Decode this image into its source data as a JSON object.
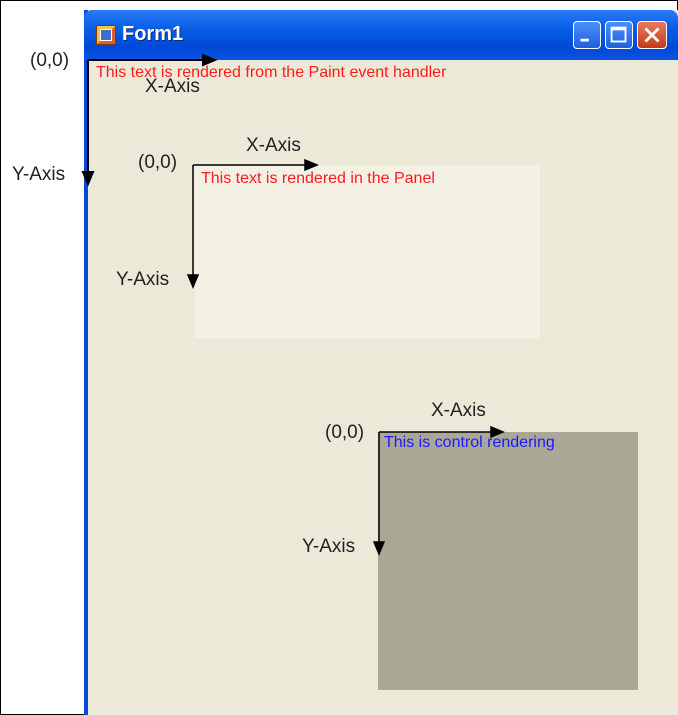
{
  "window": {
    "title": "Form1",
    "controls": {
      "minimize_icon": "minimize-icon",
      "maximize_icon": "maximize-icon",
      "close_icon": "close-icon"
    }
  },
  "form_paint": {
    "origin": "(0,0)",
    "x_axis": "X-Axis",
    "y_axis": "Y-Axis",
    "text": "This text is rendered from the Paint event handler"
  },
  "panel_paint": {
    "origin": "(0,0)",
    "x_axis": "X-Axis",
    "y_axis": "Y-Axis",
    "text": "This text is rendered in the Panel"
  },
  "control_paint": {
    "origin": "(0,0)",
    "x_axis": "X-Axis",
    "y_axis": "Y-Axis",
    "text": "This is control rendering"
  },
  "colors": {
    "window_border": "#0a49d8",
    "form_bg": "#ece9d8",
    "panel_bg": "#f3f0e4",
    "control_bg": "#aaa796",
    "red_text": "#ff1b1b",
    "blue_text": "#1a1aff"
  }
}
